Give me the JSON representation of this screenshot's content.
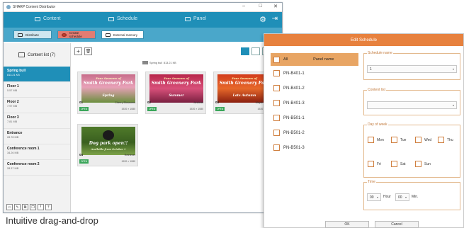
{
  "window": {
    "title": "SHARP Content Distributor",
    "controls": [
      "–",
      "□",
      "✕"
    ]
  },
  "topnav": {
    "content": "Content",
    "schedule": "Schedule",
    "panel": "Panel",
    "icons": [
      "gear-icon",
      "exit-icon"
    ]
  },
  "subnav": {
    "distribute": "Distribute",
    "create_schedule": "Create schedule",
    "external_memory": "External memory"
  },
  "sidebar": {
    "header": "Content list (7)",
    "items": [
      {
        "name": "Spring bull",
        "size": "813.21 KB"
      },
      {
        "name": "Floor 1",
        "size": "5.57 MB"
      },
      {
        "name": "Floor 2",
        "size": "7.97 MB"
      },
      {
        "name": "Floor 3",
        "size": "7.81 MB"
      },
      {
        "name": "Entrance",
        "size": "28.78 MB"
      },
      {
        "name": "Conference room 1",
        "size": "34.26 MB"
      },
      {
        "name": "Conference room 2",
        "size": "28.37 MB"
      }
    ]
  },
  "content": {
    "toolbar": {
      "add": "+",
      "delete": "🗑"
    },
    "info_name": "Spring bull",
    "info_size": "813.21 KB",
    "cards": [
      {
        "num": "01",
        "title": "Cherry Blossoms",
        "badge": "OPEN",
        "res": "1920 × 1080",
        "line1": "Four Seasons of",
        "line2": "Smith Greenery Park",
        "line3": "Spring"
      },
      {
        "num": "02",
        "title": "Azaleas",
        "badge": "OPEN",
        "res": "1920 × 1080",
        "line1": "Four Seasons of",
        "line2": "Smith Greenery Park",
        "line3": "Summer"
      },
      {
        "num": "03",
        "title": "Maple leaves",
        "badge": "OPEN",
        "res": "1920 × 1080",
        "line1": "Four Seasons of",
        "line2": "Smith Greenery Park",
        "line3": "Late Autumn"
      },
      {
        "num": "04",
        "title": "Retriever",
        "badge": "OPEN",
        "res": "1920 × 1080",
        "line1": "Dog park open!!",
        "line2": "Available from October 1",
        "line3": ""
      }
    ]
  },
  "caption": "Intuitive drag-and-drop",
  "dialog": {
    "title": "Edit Schedule",
    "all_label": "All",
    "panel_name_label": "Panel name",
    "panels": [
      "PN-B401-1",
      "PN-B401-2",
      "PN-B401-3",
      "PN-B501-1",
      "PN-B501-2",
      "PN-B501-3"
    ],
    "schedule_name_label": "Schedule name",
    "schedule_name_value": "1",
    "content_list_label": "Content list",
    "day_of_week_label": "Day of week",
    "days": [
      "Mon",
      "Tue",
      "Wed",
      "Thu",
      "Fri",
      "Sat",
      "Sun"
    ],
    "time_label": "Time",
    "hour_value": "00",
    "hour_label": "Hour",
    "min_value": "00",
    "min_label": "Min.",
    "ok": "OK",
    "cancel": "Cancel"
  }
}
